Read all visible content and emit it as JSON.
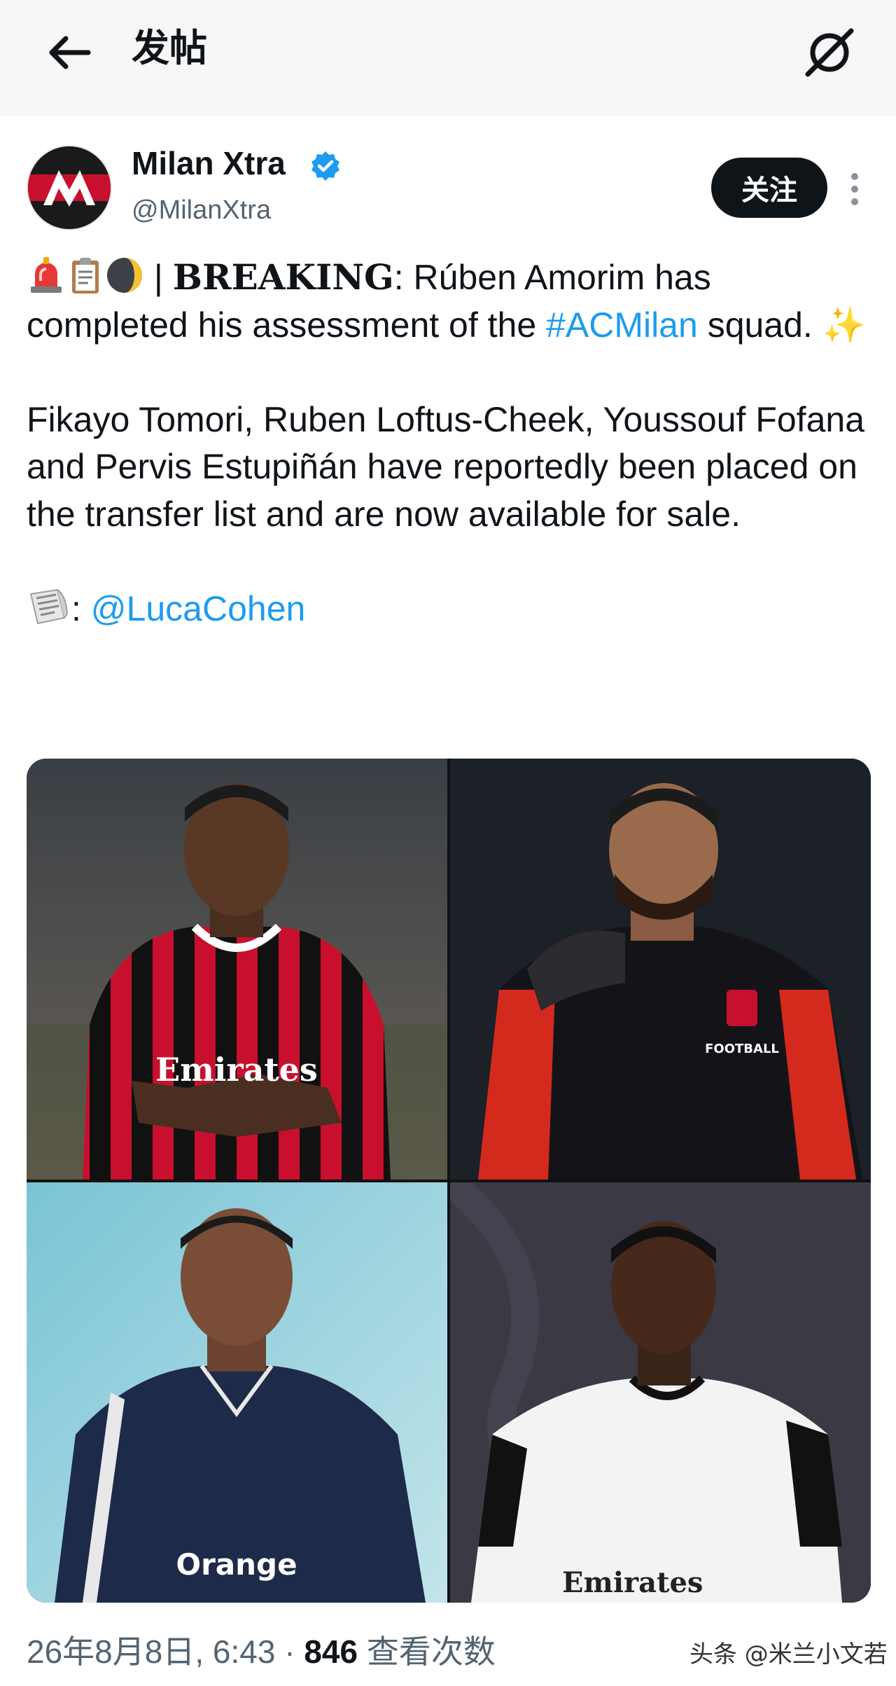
{
  "header": {
    "title": "发帖",
    "back_icon": "arrow-left-icon",
    "grok_icon": "grok-icon"
  },
  "author": {
    "name": "Milan Xtra",
    "handle": "@MilanXtra",
    "verified": true,
    "avatar_logo_text": "M",
    "follow_label": "关注"
  },
  "tweet": {
    "emojis": [
      "siren-emoji",
      "clipboard-emoji",
      "moon-emoji"
    ],
    "separator": " | ",
    "breaking": "BREAKING",
    "colon": ": ",
    "line1_rest": "Rúben Amorim has completed his assessment of the ",
    "hashtag": "#ACMilan",
    "line1_end": " squad. ",
    "sparkles": "✨",
    "paragraph2": "Fikayo Tomori, Ruben Loftus-Cheek, Youssouf Fofana and Pervis Estupiñán have reportedly been placed on the transfer list and are now available for sale.",
    "source_emoji": "newspaper-emoji",
    "source_colon": ": ",
    "source_mention": "@LucaCohen"
  },
  "media": {
    "photos": [
      {
        "kit_text": "Emirates",
        "kit_color": "#c8102e"
      },
      {
        "kit_text": "FOOTBALL",
        "kit_color": "#c8102e"
      },
      {
        "kit_text": "Orange",
        "kit_color": "#1e2a4a"
      },
      {
        "kit_text": "Emirates",
        "kit_color": "#f3f3f3"
      }
    ]
  },
  "meta": {
    "timestamp": "26年8月8日, 6:43",
    "dot": " · ",
    "views_count": "846",
    "views_label": " 查看次数"
  },
  "watermark": "头条 @米兰小文若",
  "colors": {
    "accent": "#1d9bf0",
    "text": "#0f1419",
    "secondary": "#536471",
    "milan_red": "#c8102e"
  }
}
